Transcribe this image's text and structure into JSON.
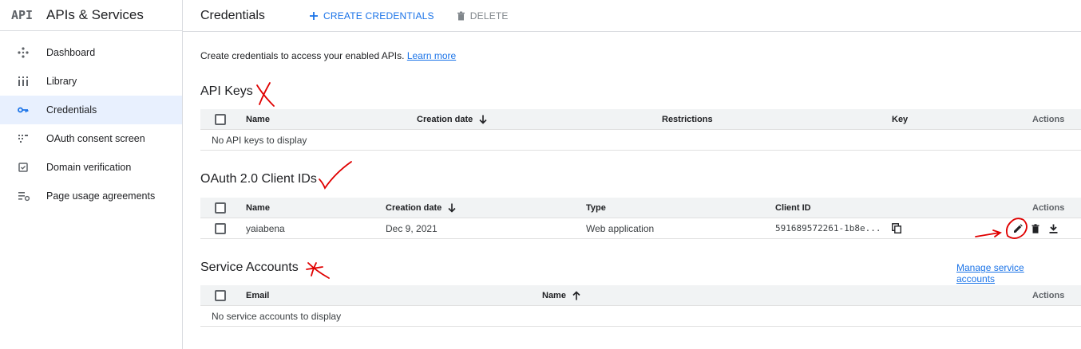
{
  "app": {
    "logo_text": "API",
    "title": "APIs & Services"
  },
  "sidebar": {
    "items": [
      {
        "label": "Dashboard",
        "icon": "dashboard-icon"
      },
      {
        "label": "Library",
        "icon": "library-icon"
      },
      {
        "label": "Credentials",
        "icon": "key-icon",
        "active": true
      },
      {
        "label": "OAuth consent screen",
        "icon": "consent-icon"
      },
      {
        "label": "Domain verification",
        "icon": "checkbox-icon"
      },
      {
        "label": "Page usage agreements",
        "icon": "settings-list-icon"
      }
    ]
  },
  "topbar": {
    "title": "Credentials",
    "create_label": "CREATE CREDENTIALS",
    "delete_label": "DELETE"
  },
  "intro": {
    "text": "Create credentials to access your enabled APIs.",
    "link": "Learn more"
  },
  "api_keys": {
    "title": "API Keys",
    "headers": {
      "name": "Name",
      "created": "Creation date",
      "restrictions": "Restrictions",
      "key": "Key",
      "actions": "Actions"
    },
    "empty": "No API keys to display"
  },
  "oauth": {
    "title": "OAuth 2.0 Client IDs",
    "headers": {
      "name": "Name",
      "created": "Creation date",
      "type": "Type",
      "client_id": "Client ID",
      "actions": "Actions"
    },
    "rows": [
      {
        "name": "yaiabena",
        "created": "Dec 9, 2021",
        "type": "Web application",
        "client_id": "591689572261-1b8e..."
      }
    ]
  },
  "service_accounts": {
    "title": "Service Accounts",
    "manage_link": "Manage service accounts",
    "headers": {
      "email": "Email",
      "name": "Name",
      "actions": "Actions"
    },
    "empty": "No service accounts to display"
  },
  "colors": {
    "accent": "#1a73e8",
    "active_bg": "#e8f0fe",
    "header_bg": "#f1f3f4",
    "annotation": "#e00000"
  }
}
